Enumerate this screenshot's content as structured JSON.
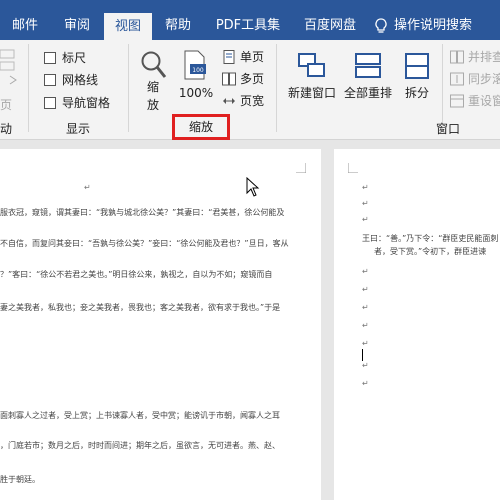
{
  "tabs": [
    "邮件",
    "审阅",
    "视图",
    "帮助",
    "PDF工具集",
    "百度网盘",
    "操作说明搜索"
  ],
  "ribbon": {
    "cut_group_label": "动",
    "cut_button_fragment": "页",
    "show_group": {
      "label": "显示",
      "checkboxes": [
        "标尺",
        "网格线",
        "导航窗格"
      ]
    },
    "zoom_group": {
      "label": "缩放",
      "zoom_button": "缩\n放",
      "zoom_button_line1": "缩",
      "zoom_button_line2": "放",
      "percent_button": "100%",
      "single_page": "单页",
      "multi_page": "多页",
      "page_width": "页宽"
    },
    "window_group": {
      "label": "窗口",
      "new_window": "新建窗口",
      "arrange_all": "全部重排",
      "split": "拆分",
      "side_by_side": "并排查",
      "sync_scroll": "同步滚",
      "reset_position": "重设窗"
    }
  },
  "document": {
    "page1_lines": [
      "服衣冠，窥镜，谓其妻曰：“我孰与城北徐公美？”其妻曰：“君美甚，徐公何能及",
      "不自信，而复问其妾曰：“吾孰与徐公美？”妾曰：“徐公何能及君也？”旦日，客从",
      "？”客曰：“徐公不若君之美也。”明日徐公来，孰视之，自以为不如；窥镜而自",
      "妻之美我者，私我也；妾之美我者，畏我也；客之美我者，欲有求于我也。”于是",
      "面刺寡人之过者，受上赏；上书谏寡人者，受中赏；能谤讥于市朝，闻寡人之耳",
      "，门庭若市；数月之后，时时而间进；期年之后，虽欲言，无可进者。燕、赵、",
      "胜于朝廷。"
    ],
    "page2_lines": [
      "王曰：“善。”乃下令：“群臣吏民能面刺",
      "者，受下赏。”令初下，群臣进谏"
    ],
    "paragraph_mark": "↵"
  }
}
